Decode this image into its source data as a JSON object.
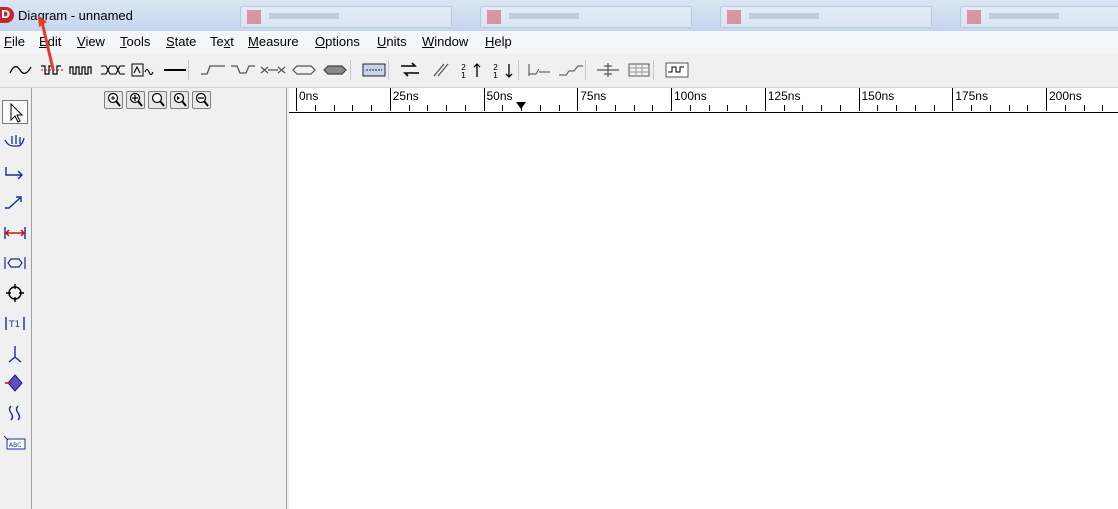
{
  "window": {
    "title": "Diagram - unnamed",
    "app_icon_letter": "D"
  },
  "menu": [
    {
      "label": "File",
      "key": "F",
      "rest": "ile"
    },
    {
      "label": "Edit",
      "key": "E",
      "rest": "dit"
    },
    {
      "label": "View",
      "key": "V",
      "rest": "iew"
    },
    {
      "label": "Tools",
      "key": "T",
      "rest": "ools"
    },
    {
      "label": "State",
      "key": "S",
      "rest": "tate"
    },
    {
      "label": "Text",
      "key": "x",
      "pre": "Te",
      "rest": "t"
    },
    {
      "label": "Measure",
      "key": "M",
      "rest": "easure"
    },
    {
      "label": "Options",
      "key": "O",
      "rest": "ptions"
    },
    {
      "label": "Units",
      "key": "U",
      "rest": "nits"
    },
    {
      "label": "Window",
      "key": "W",
      "rest": "indow"
    },
    {
      "label": "Help",
      "key": "H",
      "rest": "elp"
    }
  ],
  "toolbar_icons": [
    "sine-wave-icon",
    "clock-icon",
    "pulse-train-icon",
    "bus-icon",
    "sketch-wave-icon",
    "flat-line-icon",
    "rising-edge-icon",
    "falling-dip-icon",
    "bus-cross-icon",
    "bus-hex-icon",
    "bus-filled-icon",
    "dotted-box-icon",
    "loop-arrow-icon",
    "slash-icon",
    "sort-up-icon",
    "sort-down-icon",
    "delay-icon",
    "setup-icon",
    "insert-marker-icon",
    "grid-icon",
    "waveform-view-icon"
  ],
  "left_tools": [
    "pointer-icon",
    "hand-edit-icon",
    "edge-arrow-icon",
    "ramp-arrow-icon",
    "measure-red-icon",
    "bus-measure-icon",
    "crosshair-icon",
    "time-bracket-icon",
    "pin-icon",
    "diamond-tag-icon",
    "break-icon",
    "text-box-icon"
  ],
  "zoom_buttons": [
    "zoom-in-icon",
    "zoom-in-plus-icon",
    "zoom-normal-icon",
    "zoom-fit-icon",
    "zoom-out-icon"
  ],
  "ruler": {
    "labels": [
      "0ns",
      "25ns",
      "50ns",
      "75ns",
      "100ns",
      "125ns",
      "150ns",
      "175ns",
      "200ns"
    ],
    "cursor_ns": 60
  }
}
